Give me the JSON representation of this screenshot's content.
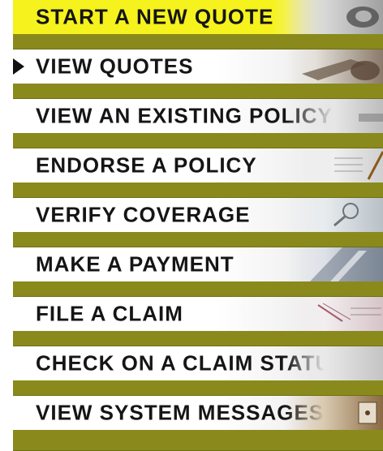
{
  "menu": {
    "items": [
      {
        "label": "START A NEW QUOTE",
        "icon": "document-pen-icon"
      },
      {
        "label": "VIEW QUOTES",
        "icon": "hand-writing-icon"
      },
      {
        "label": "VIEW AN EXISTING POLICY",
        "icon": "policy-document-icon"
      },
      {
        "label": "ENDORSE A POLICY",
        "icon": "pen-icon"
      },
      {
        "label": "VERIFY COVERAGE",
        "icon": "magnifier-icon"
      },
      {
        "label": "MAKE A PAYMENT",
        "icon": "keyboard-icon"
      },
      {
        "label": "FILE A CLAIM",
        "icon": "claims-form-icon"
      },
      {
        "label": "CHECK ON A CLAIM STATUS",
        "icon": "status-document-icon"
      },
      {
        "label": "VIEW SYSTEM MESSAGES",
        "icon": "message-icon"
      }
    ],
    "highlighted_index": 0,
    "current_index": 1
  },
  "colors": {
    "highlight": "#f6f21e",
    "separator": "#8a8a1c",
    "text": "#151515"
  }
}
